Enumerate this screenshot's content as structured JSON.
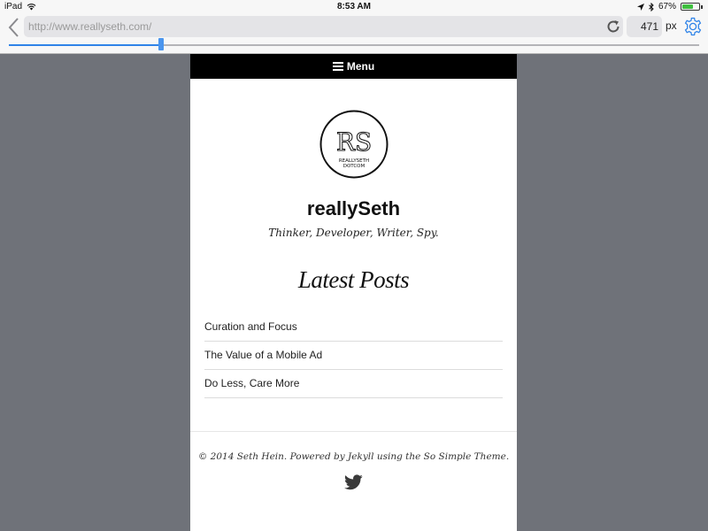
{
  "status_bar": {
    "device": "iPad",
    "time": "8:53 AM",
    "battery": "67%",
    "battery_level": 0.67,
    "icons": [
      "wifi-icon",
      "location-arrow-icon",
      "bluetooth-icon",
      "battery-icon"
    ]
  },
  "toolbar": {
    "url_placeholder": "http://www.reallyseth.com/",
    "width_value": "471",
    "unit_label": "px",
    "slider_level": 0.22,
    "accent_color": "#2f83e8",
    "icons": [
      "back-icon",
      "reload-icon",
      "gear-icon"
    ]
  },
  "site": {
    "menu_label": "Menu",
    "logo_monogram": "RS",
    "logo_line1": "REALLYSETH",
    "logo_line2": "DOTCOM",
    "title": "reallySeth",
    "tagline": "Thinker, Developer, Writer, Spy.",
    "section_heading": "Latest Posts",
    "posts": [
      {
        "title": "Curation and Focus"
      },
      {
        "title": "The Value of a Mobile Ad"
      },
      {
        "title": "Do Less, Care More"
      }
    ],
    "copyright": "© 2014 Seth Hein. Powered by Jekyll using the So Simple Theme.",
    "icons": [
      "hamburger-icon",
      "twitter-icon"
    ]
  }
}
